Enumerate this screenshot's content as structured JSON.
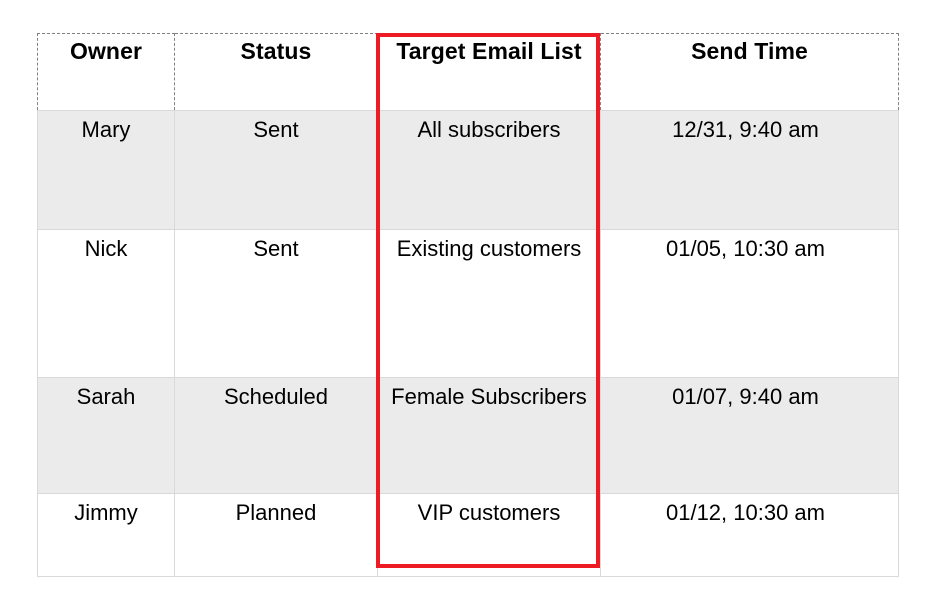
{
  "table": {
    "columns": [
      {
        "key": "owner",
        "label": "Owner"
      },
      {
        "key": "status",
        "label": "Status"
      },
      {
        "key": "target",
        "label": "Target Email List"
      },
      {
        "key": "time",
        "label": "Send Time"
      }
    ],
    "rows": [
      {
        "owner": "Mary",
        "status": "Sent",
        "target": "All subscribers",
        "time": "12/31, 9:40 am"
      },
      {
        "owner": "Nick",
        "status": "Sent",
        "target": "Existing customers",
        "time": "01/05, 10:30 am"
      },
      {
        "owner": "Sarah",
        "status": "Scheduled",
        "target": "Female Subscribers",
        "time": "01/07, 9:40 am"
      },
      {
        "owner": "Jimmy",
        "status": "Planned",
        "target": "VIP customers",
        "time": "01/12, 10:30 am"
      }
    ]
  },
  "annotation": {
    "highlight_color": "#ED1C24",
    "highlighted_column": "Target Email List"
  },
  "styles": {
    "shaded_row_background": "#ebebeb",
    "plain_row_background": "#ffffff",
    "body_border_color": "#d9d9d9",
    "header_border_color": "#808080",
    "text_color": "#000000"
  }
}
